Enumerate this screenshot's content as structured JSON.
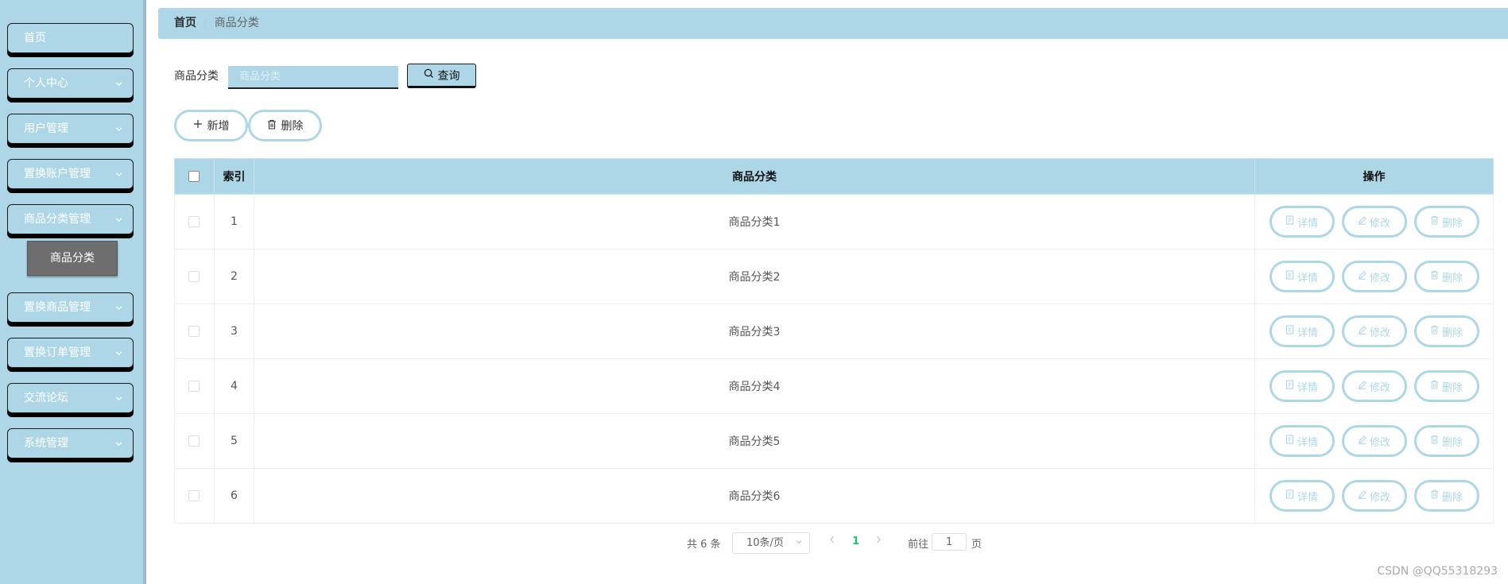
{
  "sidebar": {
    "items": [
      {
        "label": "首页",
        "has_children": false
      },
      {
        "label": "个人中心",
        "has_children": true
      },
      {
        "label": "用户管理",
        "has_children": true
      },
      {
        "label": "置换账户管理",
        "has_children": true
      },
      {
        "label": "商品分类管理",
        "has_children": true
      },
      {
        "label": "置换商品管理",
        "has_children": true
      },
      {
        "label": "置换订单管理",
        "has_children": true
      },
      {
        "label": "交流论坛",
        "has_children": true
      },
      {
        "label": "系统管理",
        "has_children": true
      }
    ],
    "active_subitem": "商品分类"
  },
  "breadcrumb": {
    "home": "首页",
    "separator": "/",
    "current": "商品分类"
  },
  "search": {
    "label": "商品分类",
    "placeholder": "商品分类",
    "value": "",
    "button_label": "查询"
  },
  "toolbar": {
    "add_label": "新增",
    "delete_label": "删除"
  },
  "table": {
    "columns": {
      "index": "索引",
      "category": "商品分类",
      "actions": "操作"
    },
    "rows": [
      {
        "index": "1",
        "category": "商品分类1"
      },
      {
        "index": "2",
        "category": "商品分类2"
      },
      {
        "index": "3",
        "category": "商品分类3"
      },
      {
        "index": "4",
        "category": "商品分类4"
      },
      {
        "index": "5",
        "category": "商品分类5"
      },
      {
        "index": "6",
        "category": "商品分类6"
      }
    ],
    "row_actions": {
      "detail": "详情",
      "edit": "修改",
      "delete": "删除"
    }
  },
  "pagination": {
    "total": "共 6 条",
    "page_size": "10条/页",
    "current_page": "1",
    "goto_label": "前往",
    "goto_value": "1",
    "page_unit": "页"
  },
  "watermark": "CSDN @QQ55318293",
  "colors": {
    "primary": "#add7e6",
    "active_menu": "#6e6e6e",
    "page_active": "#13ce66"
  }
}
